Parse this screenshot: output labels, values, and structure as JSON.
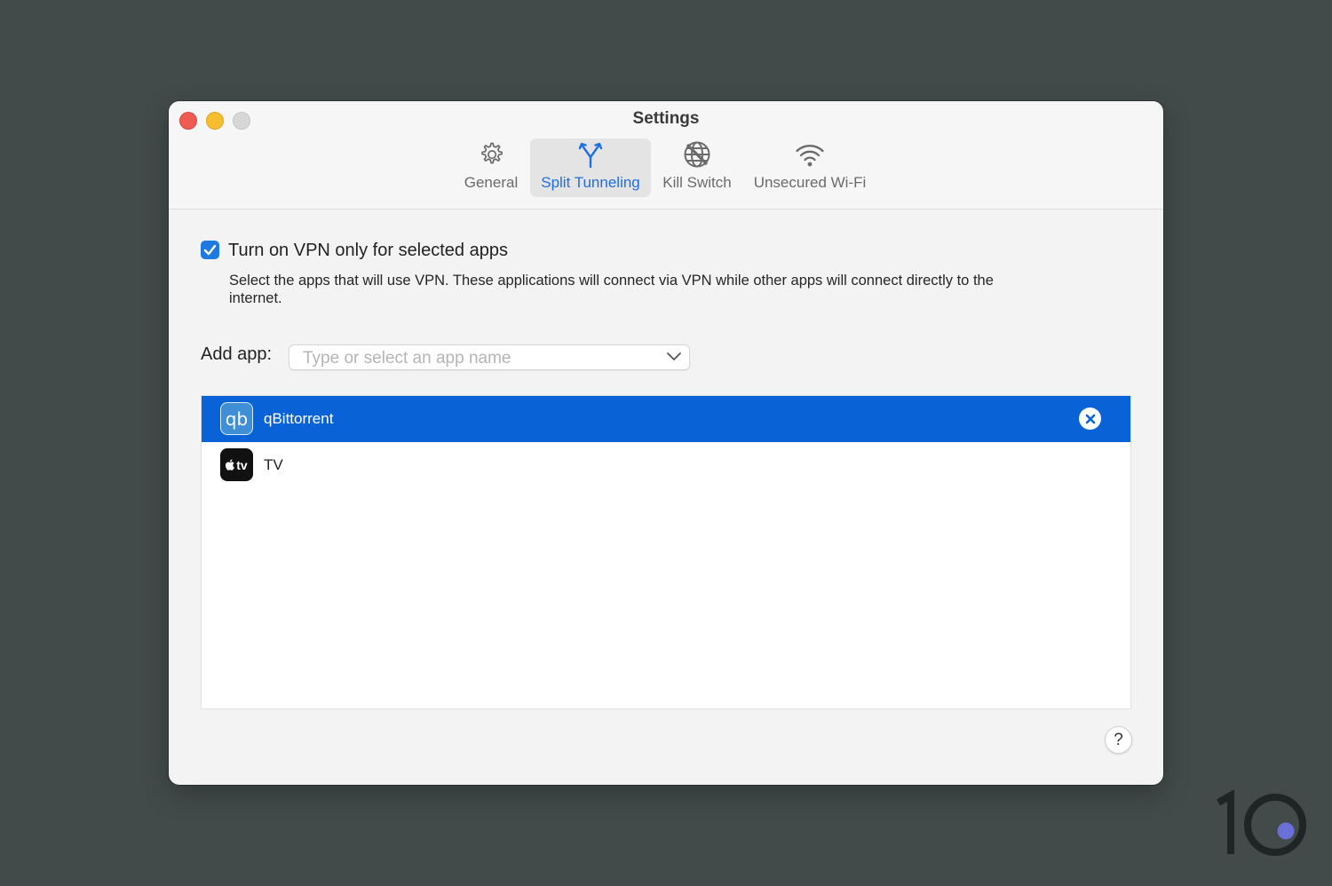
{
  "window": {
    "title": "Settings"
  },
  "tabs": [
    {
      "label": "General",
      "icon": "gear-icon",
      "active": false
    },
    {
      "label": "Split Tunneling",
      "icon": "split-arrows-icon",
      "active": true
    },
    {
      "label": "Kill Switch",
      "icon": "globe-blocked-icon",
      "active": false
    },
    {
      "label": "Unsecured Wi-Fi",
      "icon": "wifi-icon",
      "active": false
    }
  ],
  "split_tunneling": {
    "checkbox_label": "Turn on VPN only for selected apps",
    "checkbox_checked": true,
    "description": "Select the apps that will use VPN. These applications will connect via VPN while other apps will connect directly to the internet.",
    "add_app_label": "Add app:",
    "add_app_placeholder": "Type or select an app name",
    "apps": [
      {
        "name": "qBittorrent",
        "icon_text": "qb",
        "selected": true
      },
      {
        "name": "TV",
        "icon_text": "tv",
        "selected": false
      }
    ]
  },
  "help_label": "?",
  "colors": {
    "accent": "#0a63d6",
    "background": "#424a4a"
  }
}
